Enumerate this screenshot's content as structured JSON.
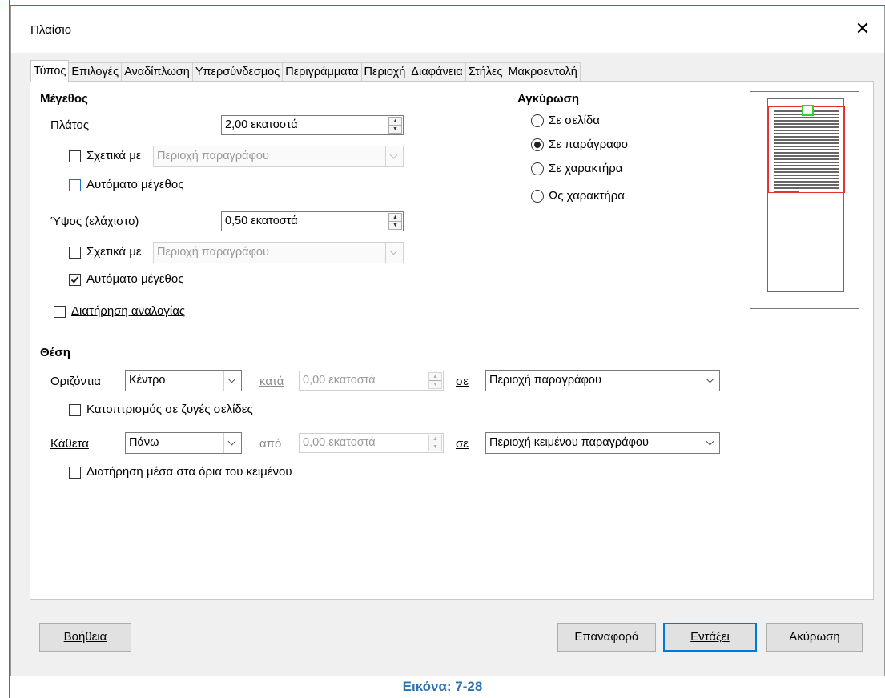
{
  "dialog": {
    "title": "Πλαίσιο",
    "close_icon": "close-icon"
  },
  "tabs": [
    {
      "label": "Τύπος",
      "active": true
    },
    {
      "label": "Επιλογές"
    },
    {
      "label": "Αναδίπλωση"
    },
    {
      "label": "Υπερσύνδεσμος"
    },
    {
      "label": "Περιγράμματα"
    },
    {
      "label": "Περιοχή"
    },
    {
      "label": "Διαφάνεια"
    },
    {
      "label": "Στήλες"
    },
    {
      "label": "Μακροεντολή"
    }
  ],
  "size": {
    "title": "Μέγεθος",
    "width_label": "Πλάτος",
    "width_value": "2,00 εκατοστά",
    "width_relative_label": "Σχετικά με",
    "width_relative_checked": false,
    "width_relative_to": "Περιοχή παραγράφου",
    "width_auto_label": "Αυτόματο μέγεθος",
    "width_auto_checked": false,
    "height_label": "Ύψος (ελάχιστο)",
    "height_value": "0,50 εκατοστά",
    "height_relative_label": "Σχετικά με",
    "height_relative_checked": false,
    "height_relative_to": "Περιοχή παραγράφου",
    "height_auto_label": "Αυτόματο μέγεθος",
    "height_auto_checked": true,
    "keep_ratio_label": "Διατήρηση αναλογίας",
    "keep_ratio_checked": false
  },
  "anchor": {
    "title": "Αγκύρωση",
    "options": [
      {
        "label": "Σε σελίδα",
        "selected": false
      },
      {
        "label": "Σε παράγραφο",
        "selected": true
      },
      {
        "label": "Σε χαρακτήρα",
        "selected": false
      },
      {
        "label": "Ως χαρακτήρα",
        "selected": false
      }
    ]
  },
  "position": {
    "title": "Θέση",
    "horizontal_label": "Οριζόντια",
    "horizontal_value": "Κέντρο",
    "horizontal_by_label": "κατά",
    "horizontal_by_value": "0,00 εκατοστά",
    "horizontal_to_label": "σε",
    "horizontal_to_value": "Περιοχή παραγράφου",
    "mirror_label": "Κατοπτρισμός σε ζυγές σελίδες",
    "mirror_checked": false,
    "vertical_label": "Κάθετα",
    "vertical_value": "Πάνω",
    "vertical_by_label": "από",
    "vertical_by_value": "0,00 εκατοστά",
    "vertical_to_label": "σε",
    "vertical_to_value": "Περιοχή κειμένου παραγράφου",
    "keep_inside_label": "Διατήρηση μέσα στα όρια του κειμένου",
    "keep_inside_checked": false
  },
  "buttons": {
    "help": "Βοήθεια",
    "reset": "Επαναφορά",
    "ok": "Εντάξει",
    "cancel": "Ακύρωση"
  },
  "caption": "Εικόνα: 7-28",
  "colors": {
    "accent": "#0078d7",
    "caption": "#2e74b5",
    "preview_area": "#e03030",
    "preview_frame": "#33cc33"
  }
}
